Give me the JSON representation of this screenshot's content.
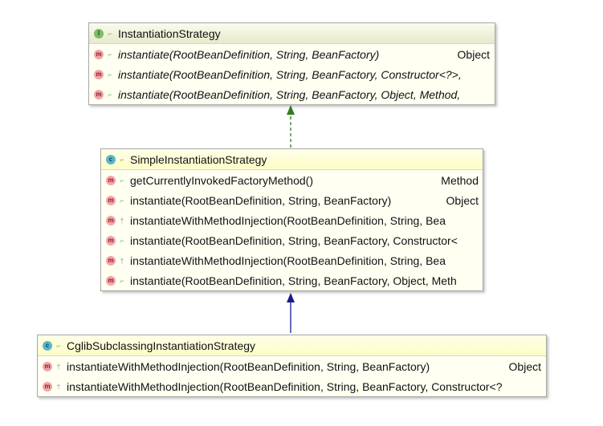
{
  "nodes": [
    {
      "title": "InstantiationStrategy",
      "kind": "I",
      "abstract": true,
      "methods": [
        {
          "name": "instantiate(RootBeanDefinition, String, BeanFactory)",
          "ret": "Object",
          "visibility": "public"
        },
        {
          "name": "instantiate(RootBeanDefinition, String, BeanFactory, Constructor<?>,",
          "ret": "",
          "visibility": "public"
        },
        {
          "name": "instantiate(RootBeanDefinition, String, BeanFactory, Object, Method,",
          "ret": "",
          "visibility": "public"
        }
      ]
    },
    {
      "title": "SimpleInstantiationStrategy",
      "kind": "C",
      "abstract": false,
      "methods": [
        {
          "name": "getCurrentlyInvokedFactoryMethod()",
          "ret": "Method",
          "visibility": "public"
        },
        {
          "name": "instantiate(RootBeanDefinition, String, BeanFactory)",
          "ret": "Object",
          "visibility": "public"
        },
        {
          "name": "instantiateWithMethodInjection(RootBeanDefinition, String, Bea",
          "ret": "",
          "visibility": "protected"
        },
        {
          "name": "instantiate(RootBeanDefinition, String, BeanFactory, Constructor<",
          "ret": "",
          "visibility": "public"
        },
        {
          "name": "instantiateWithMethodInjection(RootBeanDefinition, String, Bea",
          "ret": "",
          "visibility": "protected"
        },
        {
          "name": "instantiate(RootBeanDefinition, String, BeanFactory, Object, Meth",
          "ret": "",
          "visibility": "public"
        }
      ]
    },
    {
      "title": "CglibSubclassingInstantiationStrategy",
      "kind": "C",
      "abstract": false,
      "methods": [
        {
          "name": "instantiateWithMethodInjection(RootBeanDefinition, String, BeanFactory)",
          "ret": "Object",
          "visibility": "protected"
        },
        {
          "name": "instantiateWithMethodInjection(RootBeanDefinition, String, BeanFactory, Constructor<?",
          "ret": "",
          "visibility": "protected"
        }
      ]
    }
  ],
  "edges": [
    {
      "from": "SimpleInstantiationStrategy",
      "to": "InstantiationStrategy",
      "type": "implements",
      "color": "#2e7d1e"
    },
    {
      "from": "CglibSubclassingInstantiationStrategy",
      "to": "SimpleInstantiationStrategy",
      "type": "extends",
      "color": "#1a1a8c"
    }
  ]
}
